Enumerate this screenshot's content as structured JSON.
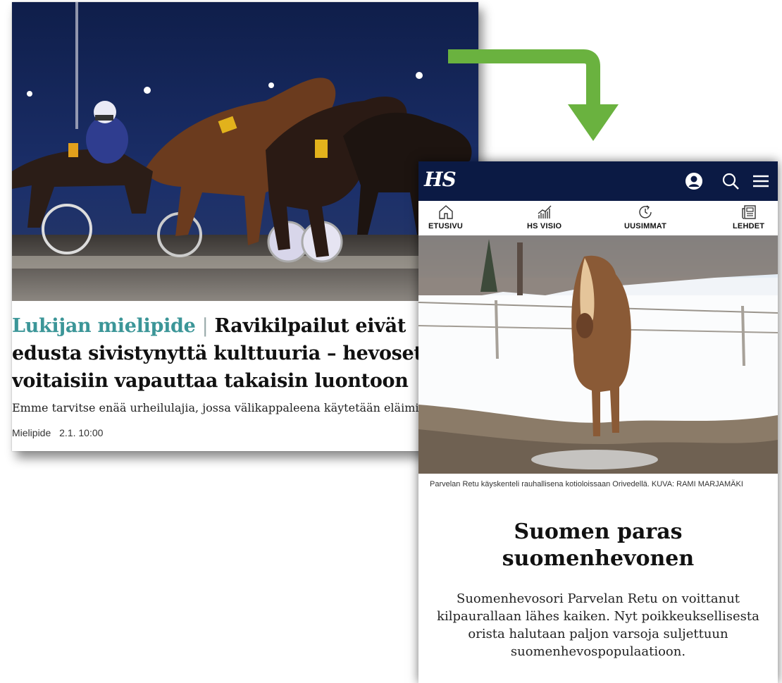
{
  "left_article": {
    "kicker": "Lukijan mielipide",
    "separator": "|",
    "headline": "Ravikilpailut eivät edusta sivistynyttä kulttuuria – hevoset voitaisiin vapauttaa takaisin luontoon",
    "lead": "Emme tarvitse enää urheilulajia, jossa välikappaleena käytetään eläimiä.",
    "section": "Mielipide",
    "timestamp": "2.1. 10:00"
  },
  "arrow": {
    "color": "#6ab23f"
  },
  "mobile": {
    "logo": "HS",
    "header_icons": [
      "user-icon",
      "search-icon",
      "menu-icon"
    ],
    "nav": [
      {
        "label": "ETUSIVU",
        "icon": "home-icon"
      },
      {
        "label": "HS VISIO",
        "icon": "chart-icon"
      },
      {
        "label": "UUSIMMAT",
        "icon": "clock-icon"
      },
      {
        "label": "LEHDET",
        "icon": "newspaper-icon"
      }
    ],
    "caption": "Parvelan Retu käyskenteli rauhallisena kotioloissaan Orivedellä.  KUVA: RAMI MARJAMÄKI",
    "title": "Suomen paras suomenhevonen",
    "lead": "Suomenhevosori Parvelan Retu on voittanut kilpaurallaan lähes kaiken. Nyt poikkeuksellisesta orista halutaan paljon varsoja suljettuun suomenhevospopulaatioon."
  },
  "colors": {
    "header_bg": "#0b1a44",
    "kicker": "#3c9698"
  }
}
